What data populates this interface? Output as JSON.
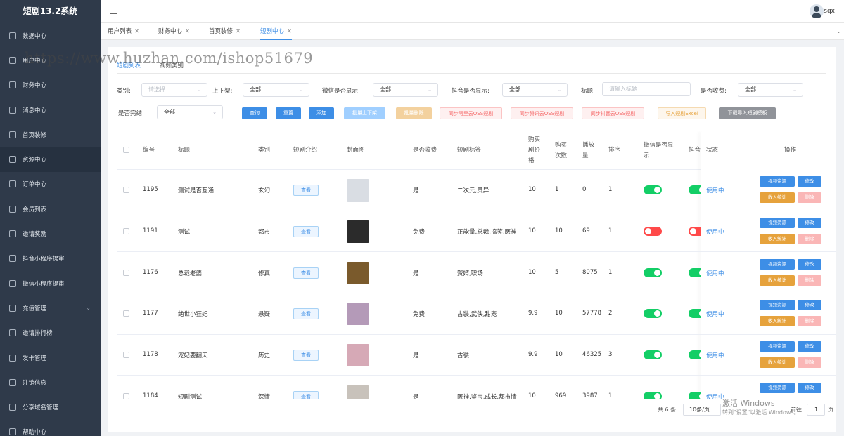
{
  "app": {
    "title": "短剧13.2系统"
  },
  "sidebar": {
    "items": [
      {
        "label": "数据中心",
        "icon": "monitor-icon"
      },
      {
        "label": "用户中心",
        "icon": "user-icon"
      },
      {
        "label": "财务中心",
        "icon": "wallet-icon"
      },
      {
        "label": "消息中心",
        "icon": "message-icon"
      },
      {
        "label": "首页装修",
        "icon": "box-icon"
      },
      {
        "label": "资源中心",
        "icon": "document-icon"
      },
      {
        "label": "订单中心",
        "icon": "order-icon"
      },
      {
        "label": "会员列表",
        "icon": "grid-icon"
      },
      {
        "label": "邀请奖励",
        "icon": "gift-icon"
      },
      {
        "label": "抖音小程序提审",
        "icon": "layers-icon"
      },
      {
        "label": "微信小程序提审",
        "icon": "grid-icon"
      },
      {
        "label": "充值管理",
        "icon": "money-icon",
        "chevron": "⌄"
      },
      {
        "label": "邀请排行榜",
        "icon": "bar-chart-icon"
      },
      {
        "label": "发卡管理",
        "icon": "card-icon"
      },
      {
        "label": "注销信息",
        "icon": "logout-icon"
      },
      {
        "label": "分享域名管理",
        "icon": "grid-icon"
      },
      {
        "label": "帮助中心",
        "icon": "help-icon"
      }
    ]
  },
  "header": {
    "username": "sqx"
  },
  "tabs": [
    {
      "label": "用户列表",
      "close": "✕"
    },
    {
      "label": "财务中心",
      "close": "✕"
    },
    {
      "label": "首页装修",
      "close": "✕"
    },
    {
      "label": "短剧中心",
      "close": "✕"
    }
  ],
  "subtabs": [
    {
      "label": "短剧列表"
    },
    {
      "label": "视频类别"
    }
  ],
  "filters": {
    "category": {
      "label": "类别:",
      "placeholder": "请选择"
    },
    "shelf": {
      "label": "上下架:",
      "value": "全部"
    },
    "wechat_show": {
      "label": "微信是否显示:",
      "value": "全部"
    },
    "douyin_show": {
      "label": "抖音是否显示:",
      "value": "全部"
    },
    "title": {
      "label": "标题:",
      "placeholder": "请输入标题"
    },
    "charge": {
      "label": "是否收费:",
      "value": "全部"
    },
    "finished": {
      "label": "是否完结:",
      "value": "全部"
    }
  },
  "actions": {
    "query": "查询",
    "reset": "重置",
    "add": "添加",
    "batch_shelf": "批量上下架",
    "batch_delete": "批量删除",
    "sync_aliyun": "同步阿里云OSS短剧",
    "sync_tencent": "同步腾讯云OSS短剧",
    "sync_douyin": "同步抖音云OSS短剧",
    "import_excel": "导入短剧Excel",
    "download_template": "下载导入短剧模板"
  },
  "table": {
    "headers": {
      "id": "编号",
      "title": "标题",
      "category": "类别",
      "intro": "短剧介绍",
      "cover": "封面图",
      "charge": "是否收费",
      "tags": "短剧标签",
      "price": "购买\n剧价\n格",
      "buy_count": "购买\n次数",
      "plays": "播放\n量",
      "sort": "排序",
      "wechat": "微信是否显\n示",
      "douyin": "抖音:",
      "status": "状态",
      "ops": "操作"
    },
    "view_label": "查看",
    "rows": [
      {
        "id": "1195",
        "title": "测试是否互通",
        "category": "玄幻",
        "charge": "是",
        "tags": "二次元,灵异",
        "price": "10",
        "buy": "1",
        "plays": "0",
        "sort": "1",
        "wechat": true,
        "douyin": true,
        "status": "使用中",
        "cover": "#d9dde3"
      },
      {
        "id": "1191",
        "title": "测试",
        "category": "都市",
        "charge": "免费",
        "tags": "正能量,总裁,搞笑,医神",
        "price": "10",
        "buy": "10",
        "plays": "69",
        "sort": "1",
        "wechat": false,
        "douyin": false,
        "status": "使用中",
        "cover": "#2b2b2b"
      },
      {
        "id": "1176",
        "title": "总裁老婆",
        "category": "修真",
        "charge": "是",
        "tags": "赘婿,职场",
        "price": "10",
        "buy": "5",
        "plays": "8075",
        "sort": "1",
        "wechat": true,
        "douyin": true,
        "status": "使用中",
        "cover": "#7a5a2c"
      },
      {
        "id": "1177",
        "title": "绝世小狂妃",
        "category": "悬疑",
        "charge": "免费",
        "tags": "古装,武侠,甜宠",
        "price": "9.9",
        "buy": "10",
        "plays": "57778",
        "sort": "2",
        "wechat": true,
        "douyin": true,
        "status": "使用中",
        "cover": "#b49ab8"
      },
      {
        "id": "1178",
        "title": "宠妃要翻天",
        "category": "历史",
        "charge": "是",
        "tags": "古装",
        "price": "9.9",
        "buy": "10",
        "plays": "46325",
        "sort": "3",
        "wechat": true,
        "douyin": true,
        "status": "使用中",
        "cover": "#d6a9b6"
      },
      {
        "id": "1184",
        "title": "短剧测试",
        "category": "深情",
        "charge": "是",
        "tags": "医神,鉴宝,成长,都市情",
        "price": "10",
        "buy": "969",
        "plays": "3987",
        "sort": "1",
        "wechat": true,
        "douyin": true,
        "status": "使用中",
        "cover": "#c8c2bb"
      }
    ],
    "op_labels": {
      "video": "视频资源",
      "edit": "修改",
      "income": "收入统计",
      "delete": "删除"
    }
  },
  "pagination": {
    "total": "共 6 条",
    "page_size": "10条/页",
    "goto": "前往",
    "page": "1",
    "page_unit": "页"
  },
  "watermark": "https://www.huzhan.com/ishop51679",
  "activation": {
    "line1": "激活 Windows",
    "line2": "转到\"设置\"以激活 Windows。"
  },
  "colors": {
    "sidebar": "#2f3a4a",
    "primary": "#3d8ee6",
    "success": "#13ce66",
    "danger": "#ff4949",
    "warning": "#e6a23c"
  }
}
